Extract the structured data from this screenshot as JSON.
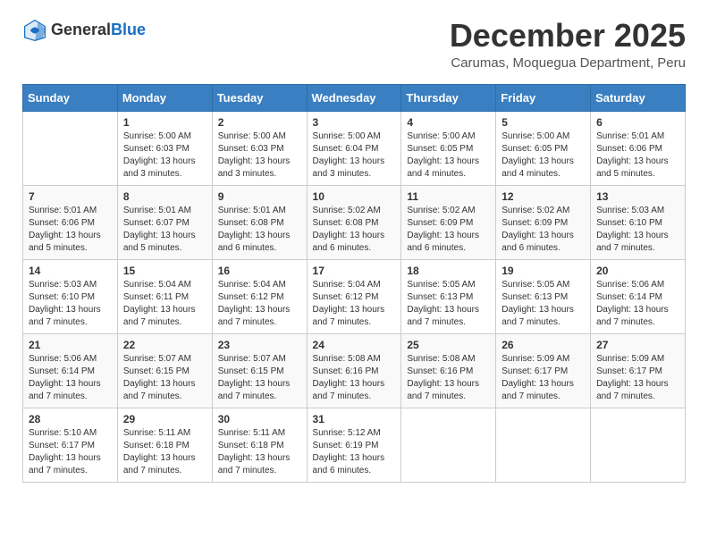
{
  "header": {
    "logo_general": "General",
    "logo_blue": "Blue",
    "month": "December 2025",
    "location": "Carumas, Moquegua Department, Peru"
  },
  "weekdays": [
    "Sunday",
    "Monday",
    "Tuesday",
    "Wednesday",
    "Thursday",
    "Friday",
    "Saturday"
  ],
  "weeks": [
    [
      {
        "day": "",
        "info": ""
      },
      {
        "day": "1",
        "info": "Sunrise: 5:00 AM\nSunset: 6:03 PM\nDaylight: 13 hours\nand 3 minutes."
      },
      {
        "day": "2",
        "info": "Sunrise: 5:00 AM\nSunset: 6:03 PM\nDaylight: 13 hours\nand 3 minutes."
      },
      {
        "day": "3",
        "info": "Sunrise: 5:00 AM\nSunset: 6:04 PM\nDaylight: 13 hours\nand 3 minutes."
      },
      {
        "day": "4",
        "info": "Sunrise: 5:00 AM\nSunset: 6:05 PM\nDaylight: 13 hours\nand 4 minutes."
      },
      {
        "day": "5",
        "info": "Sunrise: 5:00 AM\nSunset: 6:05 PM\nDaylight: 13 hours\nand 4 minutes."
      },
      {
        "day": "6",
        "info": "Sunrise: 5:01 AM\nSunset: 6:06 PM\nDaylight: 13 hours\nand 5 minutes."
      }
    ],
    [
      {
        "day": "7",
        "info": "Sunrise: 5:01 AM\nSunset: 6:06 PM\nDaylight: 13 hours\nand 5 minutes."
      },
      {
        "day": "8",
        "info": "Sunrise: 5:01 AM\nSunset: 6:07 PM\nDaylight: 13 hours\nand 5 minutes."
      },
      {
        "day": "9",
        "info": "Sunrise: 5:01 AM\nSunset: 6:08 PM\nDaylight: 13 hours\nand 6 minutes."
      },
      {
        "day": "10",
        "info": "Sunrise: 5:02 AM\nSunset: 6:08 PM\nDaylight: 13 hours\nand 6 minutes."
      },
      {
        "day": "11",
        "info": "Sunrise: 5:02 AM\nSunset: 6:09 PM\nDaylight: 13 hours\nand 6 minutes."
      },
      {
        "day": "12",
        "info": "Sunrise: 5:02 AM\nSunset: 6:09 PM\nDaylight: 13 hours\nand 6 minutes."
      },
      {
        "day": "13",
        "info": "Sunrise: 5:03 AM\nSunset: 6:10 PM\nDaylight: 13 hours\nand 7 minutes."
      }
    ],
    [
      {
        "day": "14",
        "info": "Sunrise: 5:03 AM\nSunset: 6:10 PM\nDaylight: 13 hours\nand 7 minutes."
      },
      {
        "day": "15",
        "info": "Sunrise: 5:04 AM\nSunset: 6:11 PM\nDaylight: 13 hours\nand 7 minutes."
      },
      {
        "day": "16",
        "info": "Sunrise: 5:04 AM\nSunset: 6:12 PM\nDaylight: 13 hours\nand 7 minutes."
      },
      {
        "day": "17",
        "info": "Sunrise: 5:04 AM\nSunset: 6:12 PM\nDaylight: 13 hours\nand 7 minutes."
      },
      {
        "day": "18",
        "info": "Sunrise: 5:05 AM\nSunset: 6:13 PM\nDaylight: 13 hours\nand 7 minutes."
      },
      {
        "day": "19",
        "info": "Sunrise: 5:05 AM\nSunset: 6:13 PM\nDaylight: 13 hours\nand 7 minutes."
      },
      {
        "day": "20",
        "info": "Sunrise: 5:06 AM\nSunset: 6:14 PM\nDaylight: 13 hours\nand 7 minutes."
      }
    ],
    [
      {
        "day": "21",
        "info": "Sunrise: 5:06 AM\nSunset: 6:14 PM\nDaylight: 13 hours\nand 7 minutes."
      },
      {
        "day": "22",
        "info": "Sunrise: 5:07 AM\nSunset: 6:15 PM\nDaylight: 13 hours\nand 7 minutes."
      },
      {
        "day": "23",
        "info": "Sunrise: 5:07 AM\nSunset: 6:15 PM\nDaylight: 13 hours\nand 7 minutes."
      },
      {
        "day": "24",
        "info": "Sunrise: 5:08 AM\nSunset: 6:16 PM\nDaylight: 13 hours\nand 7 minutes."
      },
      {
        "day": "25",
        "info": "Sunrise: 5:08 AM\nSunset: 6:16 PM\nDaylight: 13 hours\nand 7 minutes."
      },
      {
        "day": "26",
        "info": "Sunrise: 5:09 AM\nSunset: 6:17 PM\nDaylight: 13 hours\nand 7 minutes."
      },
      {
        "day": "27",
        "info": "Sunrise: 5:09 AM\nSunset: 6:17 PM\nDaylight: 13 hours\nand 7 minutes."
      }
    ],
    [
      {
        "day": "28",
        "info": "Sunrise: 5:10 AM\nSunset: 6:17 PM\nDaylight: 13 hours\nand 7 minutes."
      },
      {
        "day": "29",
        "info": "Sunrise: 5:11 AM\nSunset: 6:18 PM\nDaylight: 13 hours\nand 7 minutes."
      },
      {
        "day": "30",
        "info": "Sunrise: 5:11 AM\nSunset: 6:18 PM\nDaylight: 13 hours\nand 7 minutes."
      },
      {
        "day": "31",
        "info": "Sunrise: 5:12 AM\nSunset: 6:19 PM\nDaylight: 13 hours\nand 6 minutes."
      },
      {
        "day": "",
        "info": ""
      },
      {
        "day": "",
        "info": ""
      },
      {
        "day": "",
        "info": ""
      }
    ]
  ]
}
